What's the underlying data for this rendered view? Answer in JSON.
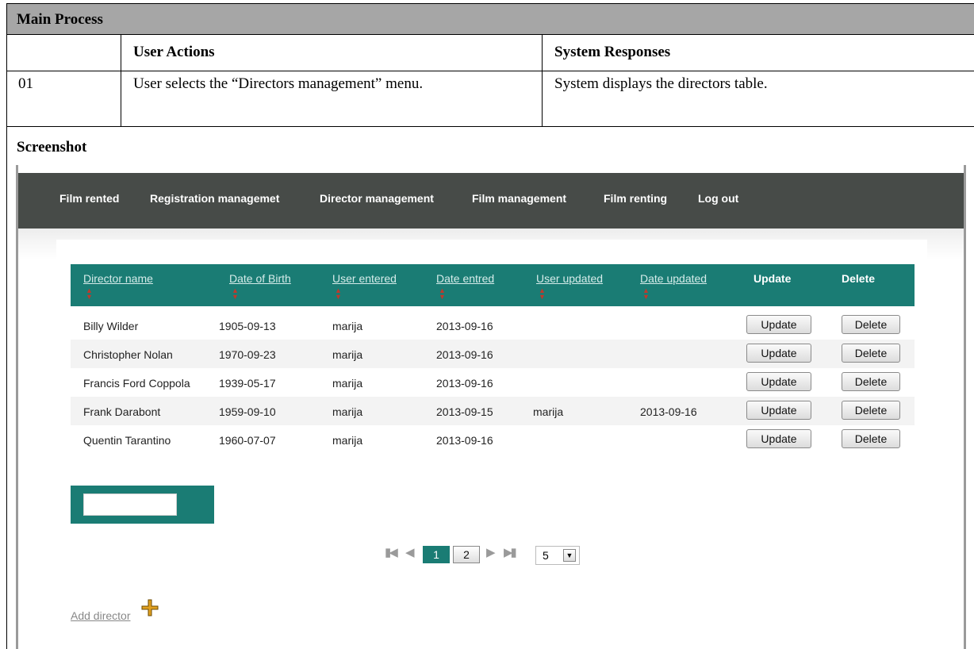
{
  "document": {
    "main_process_label": "Main Process",
    "headers": {
      "user_actions": "User Actions",
      "system_responses": "System Responses"
    },
    "steps": [
      {
        "number": "01",
        "user_action": "User selects the “Directors management” menu.",
        "system_response": "System displays the directors table."
      }
    ],
    "screenshot_label": "Screenshot"
  },
  "app": {
    "nav": [
      "Film rented",
      "Registration managemet",
      "Director management",
      "Film management",
      "Film renting",
      "Log out"
    ],
    "columns": [
      {
        "label": "Director name",
        "sortable": true
      },
      {
        "label": "Date of Birth",
        "sortable": true
      },
      {
        "label": "User entered",
        "sortable": true
      },
      {
        "label": "Date entred",
        "sortable": true
      },
      {
        "label": "User updated",
        "sortable": true
      },
      {
        "label": "Date updated",
        "sortable": true
      },
      {
        "label": "Update",
        "sortable": false
      },
      {
        "label": "Delete",
        "sortable": false
      }
    ],
    "rows": [
      {
        "name": "Billy Wilder",
        "dob": "1905-09-13",
        "user_entered": "marija",
        "date_entered": "2013-09-16",
        "user_updated": "",
        "date_updated": ""
      },
      {
        "name": "Christopher Nolan",
        "dob": "1970-09-23",
        "user_entered": "marija",
        "date_entered": "2013-09-16",
        "user_updated": "",
        "date_updated": ""
      },
      {
        "name": "Francis Ford Coppola",
        "dob": "1939-05-17",
        "user_entered": "marija",
        "date_entered": "2013-09-16",
        "user_updated": "",
        "date_updated": ""
      },
      {
        "name": "Frank Darabont",
        "dob": "1959-09-10",
        "user_entered": "marija",
        "date_entered": "2013-09-15",
        "user_updated": "marija",
        "date_updated": "2013-09-16"
      },
      {
        "name": "Quentin Tarantino",
        "dob": "1960-07-07",
        "user_entered": "marija",
        "date_entered": "2013-09-16",
        "user_updated": "",
        "date_updated": ""
      }
    ],
    "update_label": "Update",
    "delete_label": "Delete",
    "pager": {
      "first_icon": "first-page-icon",
      "prev_icon": "prev-page-icon",
      "next_icon": "next-page-icon",
      "last_icon": "last-page-icon",
      "pages": [
        "1",
        "2"
      ],
      "current_page": "1",
      "page_size": "5"
    },
    "add_link": "Add director",
    "add_icon": "plus-icon",
    "colors": {
      "nav_bg": "#474b48",
      "accent": "#1a7c74",
      "sort_arrow": "#c0392b"
    }
  }
}
